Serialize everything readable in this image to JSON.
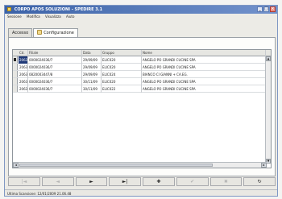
{
  "window": {
    "title": "CORPO APOS SOLUZIONI - SPEDIRE 3.1"
  },
  "menu": [
    "Sessione",
    "Modifica",
    "Visualizza",
    "Aiuto"
  ],
  "tabs": [
    {
      "label": "Accesso",
      "icon": "grid-icon",
      "active": false
    },
    {
      "label": "Configurazione",
      "icon": "settings-icon",
      "active": true
    }
  ],
  "grid": {
    "columns": [
      "Cd.",
      "Filiale",
      "Data",
      "Gruppo",
      "Nome"
    ],
    "rows": [
      [
        "2063",
        "0000024036/7",
        "29/09/09",
        "ELIC020",
        "ANGELO PO GRANDI CUCINE SPA"
      ],
      [
        "2063",
        "0000024036/7",
        "29/09/09",
        "ELIC020",
        "ANGELO PO GRANDI CUCINE SPA"
      ],
      [
        "2063",
        "0820003447/8",
        "29/09/09",
        "ELIC024",
        "BIANCO CI GIANNI + CA.EG."
      ],
      [
        "2063",
        "0000024036/7",
        "30/11/09",
        "ELIC020",
        "ANGELO PO GRANDI CUCINE SPA"
      ],
      [
        "2063",
        "0000024036/7",
        "30/11/09",
        "ELIC022",
        "ANGELO PO GRANDI CUCINE SPA"
      ]
    ],
    "selected_row": 0
  },
  "nav_buttons": [
    {
      "glyph": "|◄",
      "name": "first-record-button",
      "disabled": true
    },
    {
      "glyph": "◄",
      "name": "previous-record-button",
      "disabled": true
    },
    {
      "glyph": "►",
      "name": "next-record-button",
      "disabled": false
    },
    {
      "glyph": "►|",
      "name": "last-record-button",
      "disabled": false
    },
    {
      "glyph": "✚",
      "name": "add-record-button",
      "disabled": false
    },
    {
      "glyph": "✔",
      "name": "post-record-button",
      "disabled": true
    },
    {
      "glyph": "✖",
      "name": "cancel-record-button",
      "disabled": true
    },
    {
      "glyph": "↻",
      "name": "refresh-button",
      "disabled": false
    }
  ],
  "status": {
    "text": "Ultima Scansione: 12/01/2009 21.06.48"
  }
}
